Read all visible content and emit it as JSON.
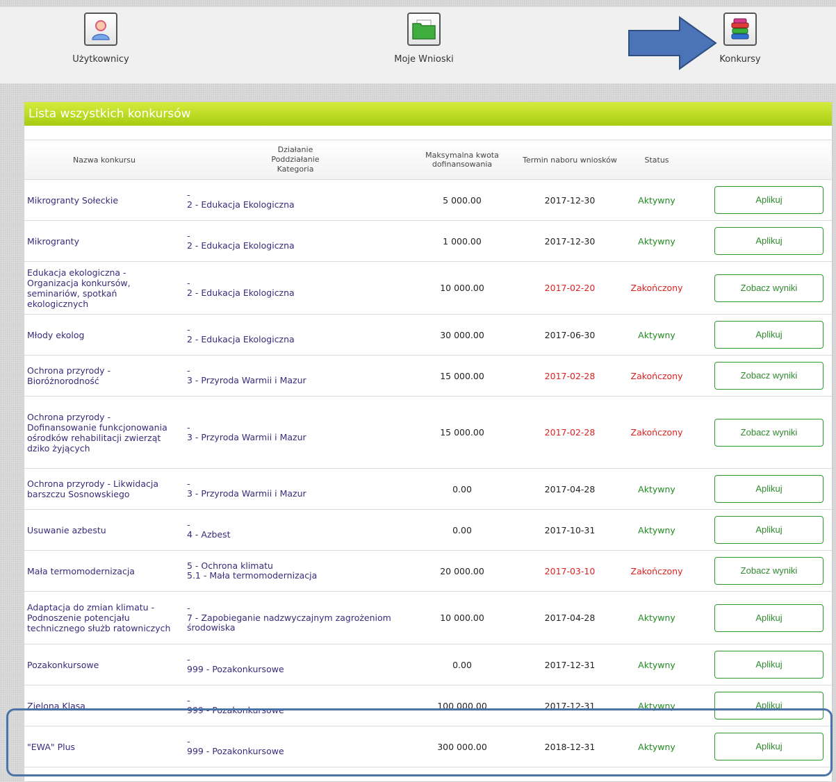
{
  "nav": {
    "items": [
      {
        "label": "Użytkownicy",
        "icon": "user-icon"
      },
      {
        "label": "Moje Wnioski",
        "icon": "folder-icon"
      },
      {
        "label": "Konkursy",
        "icon": "books-icon"
      }
    ]
  },
  "panel": {
    "title": "Lista wszystkich konkursów"
  },
  "table": {
    "headers": {
      "name": "Nazwa konkursu",
      "action_line1": "Działanie",
      "action_line2": "Poddziałanie",
      "action_line3": "Kategoria",
      "amount_line1": "Maksymalna kwota",
      "amount_line2": "dofinansowania",
      "deadline": "Termin naboru wniosków",
      "status": "Status"
    },
    "rows": [
      {
        "name": "Mikrogranty Sołeckie",
        "action1": "-",
        "action2": "2 - Edukacja Ekologiczna",
        "amount": "5 000.00",
        "deadline": "2017-12-30",
        "status": "Aktywny",
        "button": "Aplikuj",
        "active": true
      },
      {
        "name": "Mikrogranty",
        "action1": "-",
        "action2": "2 - Edukacja Ekologiczna",
        "amount": "1 000.00",
        "deadline": "2017-12-30",
        "status": "Aktywny",
        "button": "Aplikuj",
        "active": true
      },
      {
        "name": "Edukacja ekologiczna - Organizacja konkursów, seminariów, spotkań ekologicznych",
        "action1": "-",
        "action2": "2 - Edukacja Ekologiczna",
        "amount": "10 000.00",
        "deadline": "2017-02-20",
        "status": "Zakończony",
        "button": "Zobacz wyniki",
        "active": false
      },
      {
        "name": "Młody ekolog",
        "action1": "-",
        "action2": "2 - Edukacja Ekologiczna",
        "amount": "30 000.00",
        "deadline": "2017-06-30",
        "status": "Aktywny",
        "button": "Aplikuj",
        "active": true
      },
      {
        "name": "Ochrona przyrody - Bioróżnorodność",
        "action1": "-",
        "action2": "3 - Przyroda Warmii i Mazur",
        "amount": "15 000.00",
        "deadline": "2017-02-28",
        "status": "Zakończony",
        "button": "Zobacz wyniki",
        "active": false
      },
      {
        "name": "Ochrona przyrody - Dofinansowanie funkcjonowania ośrodków rehabilitacji zwierząt dziko żyjących",
        "action1": "-",
        "action2": "3 - Przyroda Warmii i Mazur",
        "amount": "15 000.00",
        "deadline": "2017-02-28",
        "status": "Zakończony",
        "button": "Zobacz wyniki",
        "active": false
      },
      {
        "name": "Ochrona przyrody - Likwidacja barszczu Sosnowskiego",
        "action1": "-",
        "action2": "3 - Przyroda Warmii i Mazur",
        "amount": "0.00",
        "deadline": "2017-04-28",
        "status": "Aktywny",
        "button": "Aplikuj",
        "active": true
      },
      {
        "name": "Usuwanie azbestu",
        "action1": "-",
        "action2": "4 - Azbest",
        "amount": "0.00",
        "deadline": "2017-10-31",
        "status": "Aktywny",
        "button": "Aplikuj",
        "active": true
      },
      {
        "name": "Mała termomodernizacja",
        "action1": "5 - Ochrona klimatu",
        "action2": "5.1 - Mała termomodernizacja",
        "amount": "20 000.00",
        "deadline": "2017-03-10",
        "status": "Zakończony",
        "button": "Zobacz wyniki",
        "active": false
      },
      {
        "name": "Adaptacja do zmian klimatu - Podnoszenie potencjału technicznego służb ratowniczych",
        "action1": "-",
        "action2": "7 - Zapobieganie nadzwyczajnym zagrożeniom środowiska",
        "amount": "10 000.00",
        "deadline": "2017-04-28",
        "status": "Aktywny",
        "button": "Aplikuj",
        "active": true
      },
      {
        "name": "Pozakonkursowe",
        "action1": "-",
        "action2": "999 - Pozakonkursowe",
        "amount": "0.00",
        "deadline": "2017-12-31",
        "status": "Aktywny",
        "button": "Aplikuj",
        "active": true
      },
      {
        "name": "Zielona Klasa",
        "action1": "-",
        "action2": "999 - Pozakonkursowe",
        "amount": "100 000.00",
        "deadline": "2017-12-31",
        "status": "Aktywny",
        "button": "Aplikuj",
        "active": true
      },
      {
        "name": "\"EWA\" Plus",
        "action1": "-",
        "action2": "999 - Pozakonkursowe",
        "amount": "300 000.00",
        "deadline": "2018-12-31",
        "status": "Aktywny",
        "button": "Aplikuj",
        "active": true
      }
    ]
  },
  "colors": {
    "accent_green": "#a8cb12",
    "status_active": "#1f8a1f",
    "status_ended": "#e02020",
    "annotation_blue": "#4a73a8"
  }
}
